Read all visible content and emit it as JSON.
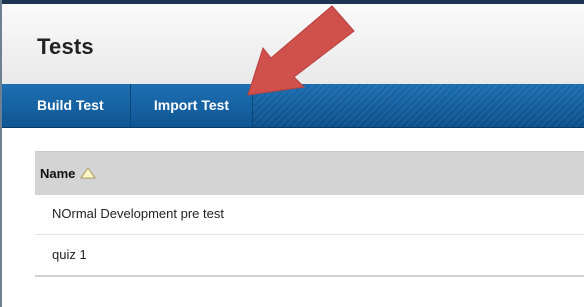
{
  "page": {
    "title": "Tests"
  },
  "action_bar": {
    "buttons": [
      {
        "label": "Build Test"
      },
      {
        "label": "Import Test"
      }
    ]
  },
  "table": {
    "columns": [
      {
        "label": "Name",
        "sort": "ascending",
        "sort_icon": "sort-up-triangle-icon"
      }
    ],
    "rows": [
      {
        "name": "NOrmal Development pre test"
      },
      {
        "name": "quiz 1"
      }
    ]
  },
  "annotation": {
    "icon": "red-arrow-icon",
    "color": "#d0504c",
    "points_to": "Import Test"
  },
  "colors": {
    "action_bar": "#0e5c9c",
    "header_bg": "#eeeeee",
    "table_header_bg": "#d4d4d4",
    "arrow": "#d0504c"
  }
}
